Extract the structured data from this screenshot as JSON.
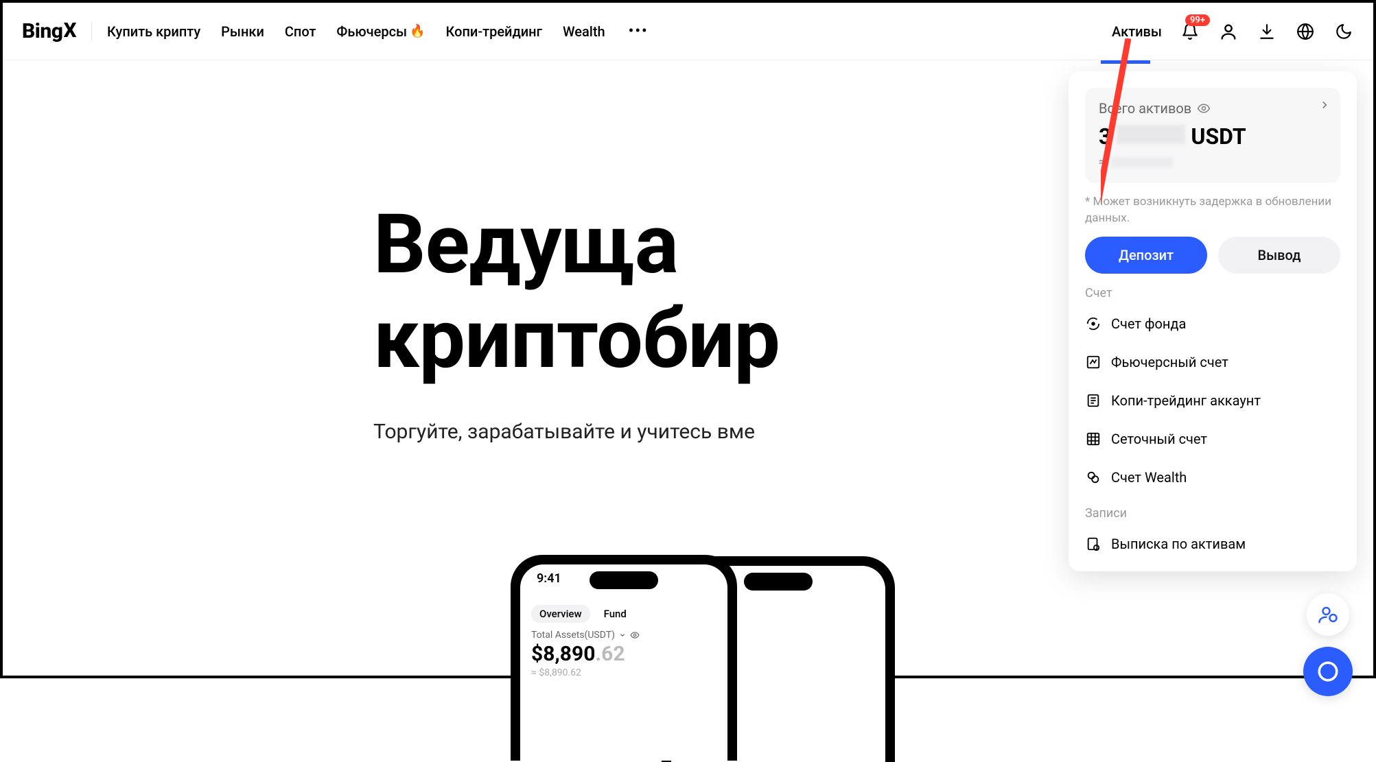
{
  "header": {
    "logo_text_a": "Bing",
    "logo_text_b": "X",
    "nav": [
      "Купить крипту",
      "Рынки",
      "Спот",
      "Фьючерсы",
      "Копи-трейдинг",
      "Wealth"
    ],
    "assets_label": "Активы",
    "notification_badge": "99+"
  },
  "hero": {
    "title_line1": "Ведуща",
    "title_line2": "криптобир",
    "subtitle": "Торгуйте, зарабатывайте и учитесь вме"
  },
  "phone": {
    "time": "9:41",
    "tab_overview": "Overview",
    "tab_fund": "Fund",
    "total_label": "Total Assets(USDT)",
    "amount_main": "$8,890",
    "amount_cents": ".62",
    "sub_amount": "≈ $8,890.62"
  },
  "dropdown": {
    "total_assets_label": "Всего активов",
    "currency": "USDT",
    "leading_digit": "3",
    "approx_prefix": "≈",
    "note": "* Может возникнуть задержка в обновлении данных.",
    "deposit": "Депозит",
    "withdraw": "Вывод",
    "section_account": "Счет",
    "account_items": [
      "Счет фонда",
      "Фьючерсный счет",
      "Копи-трейдинг аккаунт",
      "Сеточный счет",
      "Счет Wealth"
    ],
    "section_records": "Записи",
    "records_item": "Выписка по активам"
  }
}
